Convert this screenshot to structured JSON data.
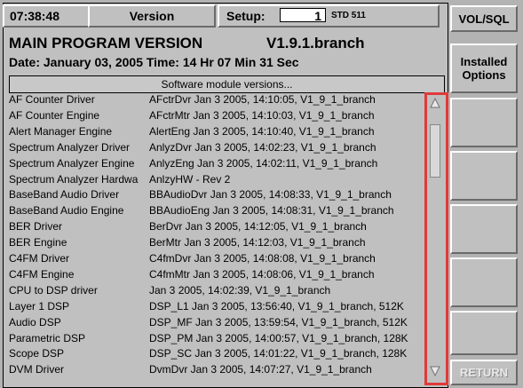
{
  "topbar": {
    "time": "07:38:48",
    "version_label": "Version",
    "setup_label": "Setup:",
    "setup_number": "1",
    "setup_name": "STD 511"
  },
  "title": {
    "program": "MAIN PROGRAM VERSION",
    "version": "V1.9.1.branch",
    "date": "Date: January 03, 2005  Time: 14 Hr 07 Min 31 Sec"
  },
  "list_header": "Software module versions...",
  "modules": [
    {
      "name": "AF Counter Driver",
      "info": "AFctrDvr Jan  3 2005, 14:10:05,  V1_9_1_branch"
    },
    {
      "name": "AF Counter Engine",
      "info": "AFctrMtr Jan  3 2005, 14:10:03,  V1_9_1_branch"
    },
    {
      "name": "Alert Manager Engine",
      "info": "AlertEng Jan  3 2005, 14:10:40,  V1_9_1_branch"
    },
    {
      "name": "Spectrum Analyzer Driver",
      "info": "AnlyzDvr Jan  3 2005, 14:02:23,  V1_9_1_branch"
    },
    {
      "name": "Spectrum Analyzer Engine",
      "info": "AnlyzEng Jan  3 2005, 14:02:11,  V1_9_1_branch"
    },
    {
      "name": "Spectrum Analyzer Hardwa",
      "info": "AnlzyHW - Rev 2"
    },
    {
      "name": "BaseBand Audio Driver",
      "info": "BBAudioDvr Jan  3 2005, 14:08:33,  V1_9_1_branch"
    },
    {
      "name": "BaseBand Audio Engine",
      "info": "BBAudioEng Jan  3 2005, 14:08:31,  V1_9_1_branch"
    },
    {
      "name": "BER Driver",
      "info": "BerDvr Jan  3 2005, 14:12:05,  V1_9_1_branch"
    },
    {
      "name": "BER Engine",
      "info": "BerMtr Jan  3 2005, 14:12:03,  V1_9_1_branch"
    },
    {
      "name": "C4FM Driver",
      "info": "C4fmDvr Jan  3 2005, 14:08:08,  V1_9_1_branch"
    },
    {
      "name": "C4FM Engine",
      "info": "C4fmMtr Jan  3 2005, 14:08:06,  V1_9_1_branch"
    },
    {
      "name": "CPU to DSP driver",
      "info": "Jan  3 2005, 14:02:39, V1_9_1_branch"
    },
    {
      "name": "Layer 1 DSP",
      "info": "DSP_L1 Jan  3 2005, 13:56:40, V1_9_1_branch, 512K"
    },
    {
      "name": "Audio DSP",
      "info": "DSP_MF Jan  3 2005, 13:59:54, V1_9_1_branch, 512K"
    },
    {
      "name": "Parametric DSP",
      "info": "DSP_PM Jan  3 2005, 14:00:57, V1_9_1_branch, 128K"
    },
    {
      "name": "Scope DSP",
      "info": "DSP_SC Jan  3 2005, 14:01:22, V1_9_1_branch, 128K"
    },
    {
      "name": "DVM Driver",
      "info": "DvmDvr Jan  3 2005, 14:07:27,  V1_9_1_branch"
    }
  ],
  "softkeys": [
    {
      "label": "VOL/SQL",
      "enabled": true
    },
    {
      "label": "Installed Options",
      "enabled": true
    },
    {
      "label": "",
      "enabled": true
    },
    {
      "label": "",
      "enabled": true
    },
    {
      "label": "",
      "enabled": true
    },
    {
      "label": "",
      "enabled": true
    },
    {
      "label": "",
      "enabled": true
    },
    {
      "label": "RETURN",
      "enabled": false
    }
  ],
  "colors": {
    "highlight_border": "#e03a3a",
    "panel": "#c0c0c0"
  }
}
